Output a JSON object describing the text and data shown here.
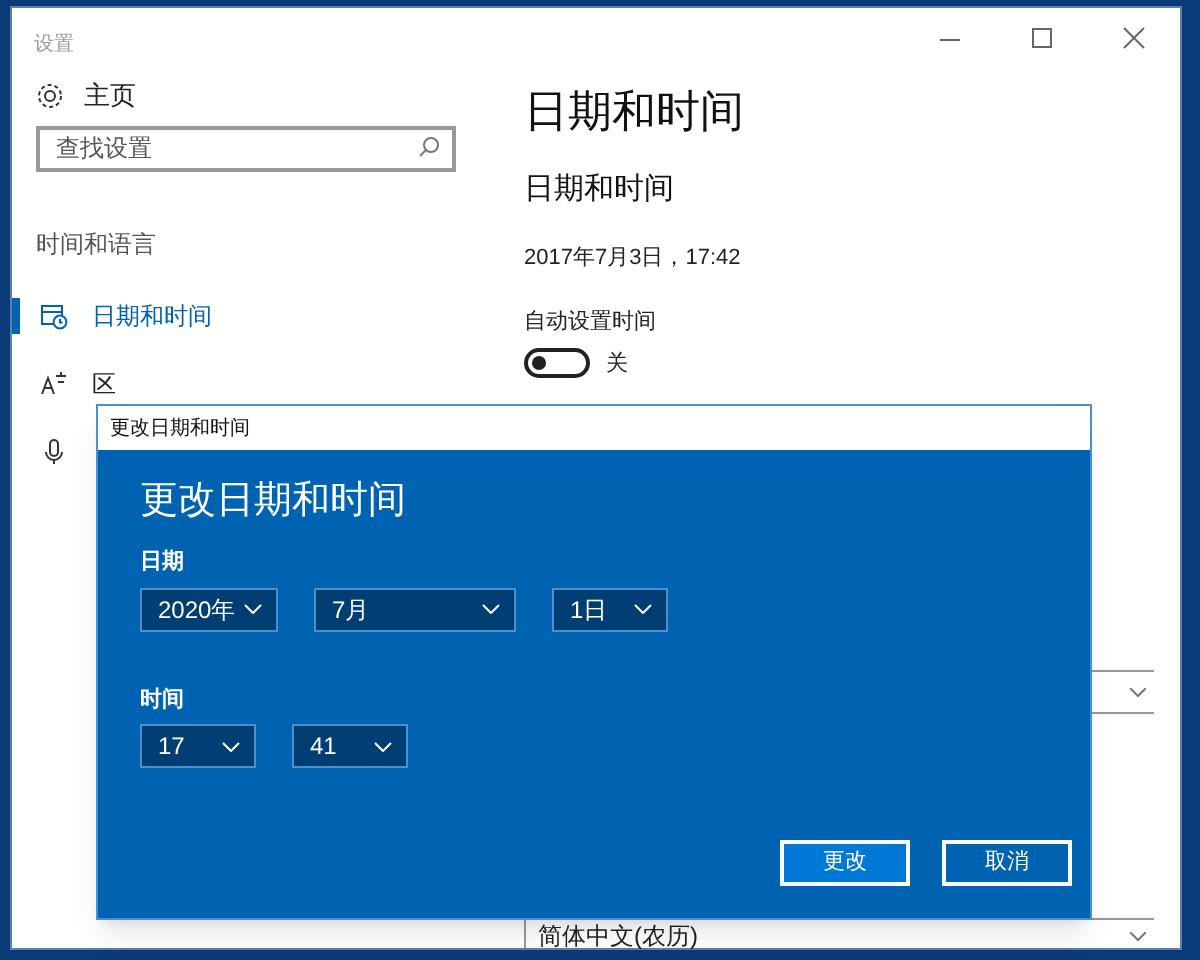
{
  "window": {
    "title": "设置"
  },
  "sidebar": {
    "home": "主页",
    "search": {
      "placeholder": "查找设置"
    },
    "section": "时间和语言",
    "items": [
      {
        "label": "日期和时间",
        "selected": true,
        "kind": "clock"
      },
      {
        "label": "区",
        "selected": false,
        "kind": "region"
      },
      {
        "selected": false,
        "kind": "speech"
      }
    ]
  },
  "content": {
    "title": "日期和时间",
    "subtitle": "日期和时间",
    "current": "2017年7月3日，17:42",
    "auto_time": {
      "label": "自动设置时间",
      "on": false,
      "state": "关"
    },
    "calendar_dropdown": {
      "value": "简体中文(农历)"
    }
  },
  "dialog": {
    "title": "更改日期和时间",
    "heading": "更改日期和时间",
    "date_label": "日期",
    "date_fields": [
      "2020年",
      "7月",
      "1日"
    ],
    "time_label": "时间",
    "time_fields": [
      "17",
      "41"
    ],
    "buttons": [
      {
        "label": "更改",
        "primary": true
      },
      {
        "label": "取消",
        "primary": false
      }
    ]
  }
}
